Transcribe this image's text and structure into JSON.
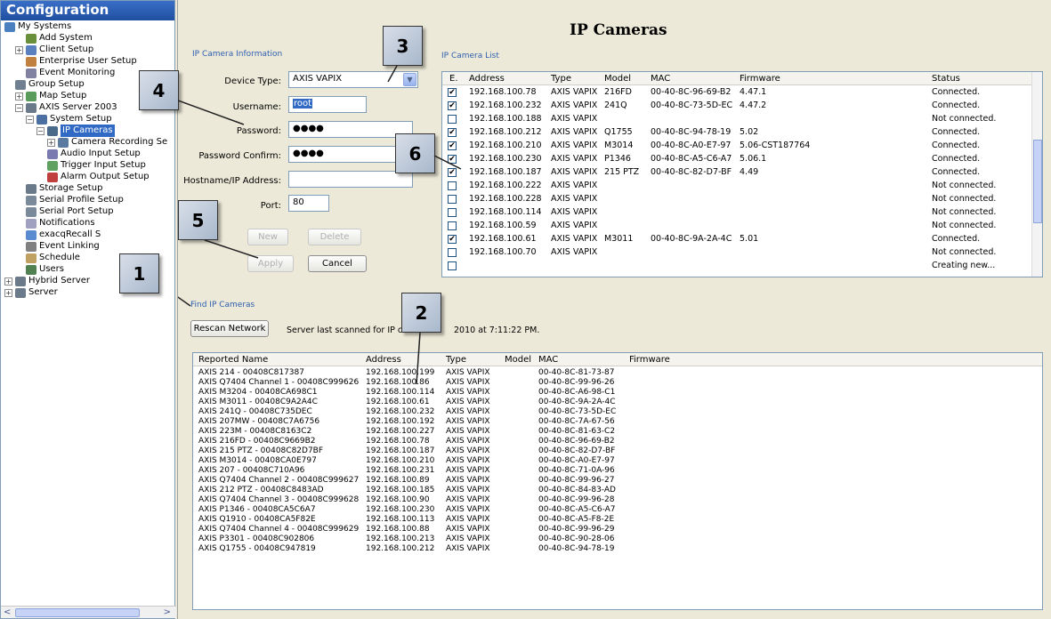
{
  "sidebar": {
    "title": "Configuration",
    "items": [
      {
        "label": "My Systems",
        "icon": "systems-icon",
        "color": "#4a7fc0"
      },
      {
        "label": "Add System",
        "icon": "add-system-icon",
        "color": "#6a8f3a"
      },
      {
        "label": "Client Setup",
        "icon": "client-setup-icon",
        "color": "#5a7fbf"
      },
      {
        "label": "Enterprise User Setup",
        "icon": "enterprise-user-icon",
        "color": "#c08040"
      },
      {
        "label": "Event Monitoring",
        "icon": "event-monitoring-icon",
        "color": "#8080a0"
      },
      {
        "label": "Group Setup",
        "icon": "group-setup-icon",
        "color": "#708090"
      },
      {
        "label": "Map Setup",
        "icon": "map-setup-icon",
        "color": "#5a9a5a"
      },
      {
        "label": "AXIS Server 2003",
        "icon": "server-icon",
        "color": "#6a7a8a"
      },
      {
        "label": "System Setup",
        "icon": "system-setup-icon",
        "color": "#4a6fa0"
      },
      {
        "label": "IP Cameras",
        "icon": "ip-cameras-icon",
        "color": "#4a6a8a"
      },
      {
        "label": "Camera Recording Se",
        "icon": "camera-recording-icon",
        "color": "#5a7aa0"
      },
      {
        "label": "Audio Input Setup",
        "icon": "audio-input-icon",
        "color": "#7a7ab0"
      },
      {
        "label": "Trigger Input Setup",
        "icon": "trigger-input-icon",
        "color": "#60a060"
      },
      {
        "label": "Alarm Output Setup",
        "icon": "alarm-output-icon",
        "color": "#c04040"
      },
      {
        "label": "Storage Setup",
        "icon": "storage-icon",
        "color": "#6a7a8a"
      },
      {
        "label": "Serial Profile Setup",
        "icon": "serial-profile-icon",
        "color": "#7a8a9a"
      },
      {
        "label": "Serial Port Setup",
        "icon": "serial-port-icon",
        "color": "#7a8a9a"
      },
      {
        "label": "Notifications",
        "icon": "notifications-icon",
        "color": "#a0a0c0"
      },
      {
        "label": "exacqRecall S",
        "icon": "exacqrecall-icon",
        "color": "#5a8ad0"
      },
      {
        "label": "Event Linking",
        "icon": "event-linking-icon",
        "color": "#808080"
      },
      {
        "label": "Schedule",
        "icon": "schedule-icon",
        "color": "#c0a060"
      },
      {
        "label": "Users",
        "icon": "users-icon",
        "color": "#508050"
      },
      {
        "label": "Hybrid Server",
        "icon": "hybrid-server-icon",
        "color": "#6a7a8a"
      },
      {
        "label": "Server",
        "icon": "server2-icon",
        "color": "#6a7a8a"
      }
    ]
  },
  "page": {
    "title": "IP Cameras"
  },
  "info": {
    "section": "IP Camera Information",
    "device_type_label": "Device Type:",
    "device_type_value": "AXIS VAPIX",
    "username_label": "Username:",
    "username_value": "root",
    "password_label": "Password:",
    "password_value": "●●●●",
    "confirm_label": "Password Confirm:",
    "confirm_value": "●●●●",
    "host_label": "Hostname/IP Address:",
    "host_value": "",
    "port_label": "Port:",
    "port_value": "80",
    "new_btn": "New",
    "delete_btn": "Delete",
    "apply_btn": "Apply",
    "cancel_btn": "Cancel"
  },
  "list": {
    "section": "IP Camera List",
    "headers": [
      "E.",
      "Address",
      "Type",
      "Model",
      "MAC",
      "Firmware",
      "Status"
    ],
    "rows": [
      {
        "checked": true,
        "address": "192.168.100.78",
        "type": "AXIS VAPIX",
        "model": "216FD",
        "mac": "00-40-8C-96-69-B2",
        "fw": "4.47.1",
        "status": "Connected."
      },
      {
        "checked": true,
        "address": "192.168.100.232",
        "type": "AXIS VAPIX",
        "model": "241Q",
        "mac": "00-40-8C-73-5D-EC",
        "fw": "4.47.2",
        "status": "Connected."
      },
      {
        "checked": false,
        "address": "192.168.100.188",
        "type": "AXIS VAPIX",
        "model": "",
        "mac": "",
        "fw": "",
        "status": "Not connected."
      },
      {
        "checked": true,
        "address": "192.168.100.212",
        "type": "AXIS VAPIX",
        "model": "Q1755",
        "mac": "00-40-8C-94-78-19",
        "fw": "5.02",
        "status": "Connected."
      },
      {
        "checked": true,
        "address": "192.168.100.210",
        "type": "AXIS VAPIX",
        "model": "M3014",
        "mac": "00-40-8C-A0-E7-97",
        "fw": "5.06-CST187764",
        "status": "Connected."
      },
      {
        "checked": true,
        "address": "192.168.100.230",
        "type": "AXIS VAPIX",
        "model": "P1346",
        "mac": "00-40-8C-A5-C6-A7",
        "fw": "5.06.1",
        "status": "Connected."
      },
      {
        "checked": true,
        "address": "192.168.100.187",
        "type": "AXIS VAPIX",
        "model": "215 PTZ",
        "mac": "00-40-8C-82-D7-BF",
        "fw": "4.49",
        "status": "Connected."
      },
      {
        "checked": false,
        "address": "192.168.100.222",
        "type": "AXIS VAPIX",
        "model": "",
        "mac": "",
        "fw": "",
        "status": "Not connected."
      },
      {
        "checked": false,
        "address": "192.168.100.228",
        "type": "AXIS VAPIX",
        "model": "",
        "mac": "",
        "fw": "",
        "status": "Not connected."
      },
      {
        "checked": false,
        "address": "192.168.100.114",
        "type": "AXIS VAPIX",
        "model": "",
        "mac": "",
        "fw": "",
        "status": "Not connected."
      },
      {
        "checked": false,
        "address": "192.168.100.59",
        "type": "AXIS VAPIX",
        "model": "",
        "mac": "",
        "fw": "",
        "status": "Not connected."
      },
      {
        "checked": true,
        "address": "192.168.100.61",
        "type": "AXIS VAPIX",
        "model": "M3011",
        "mac": "00-40-8C-9A-2A-4C",
        "fw": "5.01",
        "status": "Connected."
      },
      {
        "checked": false,
        "address": "192.168.100.70",
        "type": "AXIS VAPIX",
        "model": "",
        "mac": "",
        "fw": "",
        "status": "Not connected."
      },
      {
        "checked": false,
        "address": "",
        "type": "",
        "model": "",
        "mac": "",
        "fw": "",
        "status": "Creating new..."
      }
    ]
  },
  "find": {
    "section": "Find IP Cameras",
    "rescan_btn": "Rescan Network",
    "scan_text": "Server last scanned for IP cam",
    "scan_time": "2010 at 7:11:22 PM.",
    "headers": [
      "Reported Name",
      "Address",
      "Type",
      "Model",
      "MAC",
      "Firmware"
    ],
    "rows": [
      {
        "name": "AXIS 214 - 00408C817387",
        "address": "192.168.100.199",
        "type": "AXIS VAPIX",
        "mac": "00-40-8C-81-73-87"
      },
      {
        "name": "AXIS Q7404 Channel 1 - 00408C999626",
        "address": "192.168.100.86",
        "type": "AXIS VAPIX",
        "mac": "00-40-8C-99-96-26"
      },
      {
        "name": "AXIS M3204 - 00408CA698C1",
        "address": "192.168.100.114",
        "type": "AXIS VAPIX",
        "mac": "00-40-8C-A6-98-C1"
      },
      {
        "name": "AXIS M3011 - 00408C9A2A4C",
        "address": "192.168.100.61",
        "type": "AXIS VAPIX",
        "mac": "00-40-8C-9A-2A-4C"
      },
      {
        "name": "AXIS 241Q - 00408C735DEC",
        "address": "192.168.100.232",
        "type": "AXIS VAPIX",
        "mac": "00-40-8C-73-5D-EC"
      },
      {
        "name": "AXIS 207MW - 00408C7A6756",
        "address": "192.168.100.192",
        "type": "AXIS VAPIX",
        "mac": "00-40-8C-7A-67-56"
      },
      {
        "name": "AXIS 223M - 00408C8163C2",
        "address": "192.168.100.227",
        "type": "AXIS VAPIX",
        "mac": "00-40-8C-81-63-C2"
      },
      {
        "name": "AXIS 216FD - 00408C9669B2",
        "address": "192.168.100.78",
        "type": "AXIS VAPIX",
        "mac": "00-40-8C-96-69-B2"
      },
      {
        "name": "AXIS 215 PTZ - 00408C82D7BF",
        "address": "192.168.100.187",
        "type": "AXIS VAPIX",
        "mac": "00-40-8C-82-D7-BF"
      },
      {
        "name": "AXIS M3014 - 00408CA0E797",
        "address": "192.168.100.210",
        "type": "AXIS VAPIX",
        "mac": "00-40-8C-A0-E7-97"
      },
      {
        "name": "AXIS 207 - 00408C710A96",
        "address": "192.168.100.231",
        "type": "AXIS VAPIX",
        "mac": "00-40-8C-71-0A-96"
      },
      {
        "name": "AXIS Q7404 Channel 2 - 00408C999627",
        "address": "192.168.100.89",
        "type": "AXIS VAPIX",
        "mac": "00-40-8C-99-96-27"
      },
      {
        "name": "AXIS 212 PTZ - 00408C8483AD",
        "address": "192.168.100.185",
        "type": "AXIS VAPIX",
        "mac": "00-40-8C-84-83-AD"
      },
      {
        "name": "AXIS Q7404 Channel 3 - 00408C999628",
        "address": "192.168.100.90",
        "type": "AXIS VAPIX",
        "mac": "00-40-8C-99-96-28"
      },
      {
        "name": "AXIS P1346 - 00408CA5C6A7",
        "address": "192.168.100.230",
        "type": "AXIS VAPIX",
        "mac": "00-40-8C-A5-C6-A7"
      },
      {
        "name": "AXIS Q1910 - 00408CA5F82E",
        "address": "192.168.100.113",
        "type": "AXIS VAPIX",
        "mac": "00-40-8C-A5-F8-2E"
      },
      {
        "name": "AXIS Q7404 Channel 4 - 00408C999629",
        "address": "192.168.100.88",
        "type": "AXIS VAPIX",
        "mac": "00-40-8C-99-96-29"
      },
      {
        "name": "AXIS P3301 - 00408C902806",
        "address": "192.168.100.213",
        "type": "AXIS VAPIX",
        "mac": "00-40-8C-90-28-06"
      },
      {
        "name": "AXIS Q1755 - 00408C947819",
        "address": "192.168.100.212",
        "type": "AXIS VAPIX",
        "mac": "00-40-8C-94-78-19"
      }
    ]
  },
  "callouts": [
    "1",
    "2",
    "3",
    "4",
    "5",
    "6"
  ]
}
